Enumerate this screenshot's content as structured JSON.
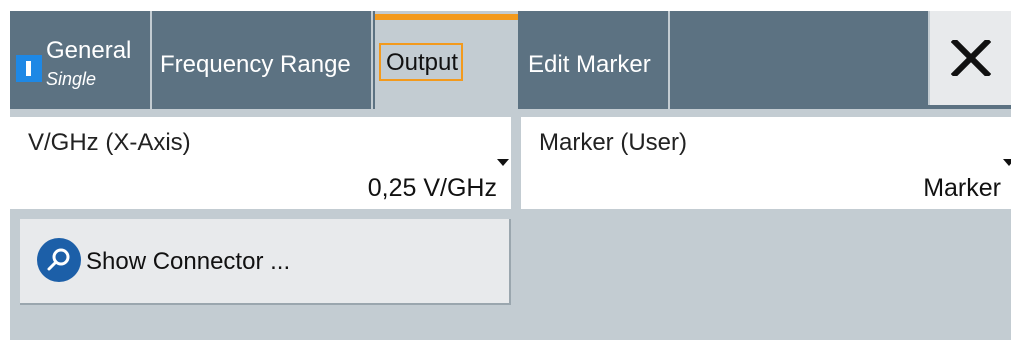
{
  "tabs": [
    {
      "label": "General",
      "sublabel": "Single"
    },
    {
      "label": "Frequency Range"
    },
    {
      "label": "Output",
      "active": true
    },
    {
      "label": "Edit Marker"
    }
  ],
  "close": {
    "icon": "close-icon"
  },
  "fields": {
    "x_axis": {
      "label": "V/GHz (X-Axis)",
      "value": "0,25 V/GHz"
    },
    "marker": {
      "label": "Marker (User)",
      "value": "Marker"
    }
  },
  "buttons": {
    "show_connector": {
      "label": "Show Connector ...",
      "icon": "search-icon"
    }
  },
  "colors": {
    "tab_bg": "#5c7282",
    "panel_bg": "#c3ccd2",
    "accent": "#f39a1d",
    "indicator": "#1e88e5",
    "search_icon_bg": "#1c5fa8"
  }
}
